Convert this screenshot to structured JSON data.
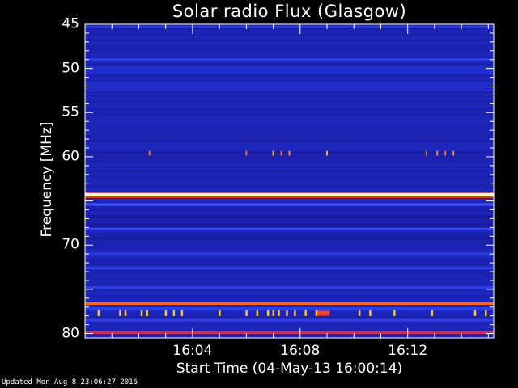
{
  "chart_data": {
    "type": "heatmap",
    "title": "Solar radio Flux (Glasgow)",
    "xlabel": "Start Time (04-May-13 16:00:14)",
    "ylabel": "Frequency [MHz]",
    "x_range_minutes": [
      0,
      15.2
    ],
    "x_ticks": [
      {
        "minute": 4,
        "label": "16:04"
      },
      {
        "minute": 8,
        "label": "16:08"
      },
      {
        "minute": 12,
        "label": "16:12"
      }
    ],
    "ylim": [
      45,
      80.5
    ],
    "y_ticks": [
      45,
      50,
      55,
      60,
      65,
      70,
      75,
      80
    ],
    "y_tick_labels": [
      "45",
      "50",
      "55",
      "60",
      "",
      "70",
      "",
      "80"
    ],
    "y_inverted": true,
    "colormap": [
      "#1a1a9a",
      "#2030d0",
      "#3c50ff",
      "#ff2020",
      "#ffb000",
      "#ffffb0"
    ],
    "background_level": 0.1,
    "bands": [
      {
        "freq": 45.3,
        "width": 0.2,
        "level": 0.35
      },
      {
        "freq": 49.0,
        "width": 0.3,
        "level": 0.28
      },
      {
        "freq": 50.2,
        "width": 0.8,
        "level": 0.2
      },
      {
        "freq": 52.0,
        "width": 1.0,
        "level": 0.18
      },
      {
        "freq": 59.5,
        "width": 0.3,
        "level": 0.03
      },
      {
        "freq": 64.3,
        "width": 0.4,
        "level": 1.0
      },
      {
        "freq": 65.4,
        "width": 0.3,
        "level": 0.4
      },
      {
        "freq": 66.8,
        "width": 0.5,
        "level": 0.01
      },
      {
        "freq": 67.7,
        "width": 0.4,
        "level": 0.02
      },
      {
        "freq": 68.2,
        "width": 0.3,
        "level": 0.35
      },
      {
        "freq": 69.3,
        "width": 0.3,
        "level": 0.02
      },
      {
        "freq": 71.0,
        "width": 0.4,
        "level": 0.25
      },
      {
        "freq": 72.6,
        "width": 0.3,
        "level": 0.3
      },
      {
        "freq": 74.8,
        "width": 0.3,
        "level": 0.3
      },
      {
        "freq": 75.8,
        "width": 0.3,
        "level": 0.05
      },
      {
        "freq": 76.6,
        "width": 0.3,
        "level": 0.7
      },
      {
        "freq": 77.2,
        "width": 0.3,
        "level": 0.3
      },
      {
        "freq": 78.5,
        "width": 0.3,
        "level": 0.28
      },
      {
        "freq": 79.9,
        "width": 0.3,
        "level": 0.55
      }
    ],
    "spots": [
      {
        "minute": 2.4,
        "freq": 59.6,
        "level": 0.7
      },
      {
        "minute": 6.0,
        "freq": 59.6,
        "level": 0.7
      },
      {
        "minute": 7.0,
        "freq": 59.6,
        "level": 0.8
      },
      {
        "minute": 7.3,
        "freq": 59.6,
        "level": 0.7
      },
      {
        "minute": 7.6,
        "freq": 59.6,
        "level": 0.75
      },
      {
        "minute": 9.0,
        "freq": 59.6,
        "level": 0.8
      },
      {
        "minute": 12.7,
        "freq": 59.6,
        "level": 0.7
      },
      {
        "minute": 13.1,
        "freq": 59.6,
        "level": 0.75
      },
      {
        "minute": 13.4,
        "freq": 59.6,
        "level": 0.7
      },
      {
        "minute": 13.7,
        "freq": 59.6,
        "level": 0.75
      }
    ],
    "bursts": {
      "freq": 77.7,
      "level": 0.85,
      "minutes": [
        0.5,
        1.3,
        1.5,
        2.1,
        2.3,
        3.0,
        3.3,
        3.6,
        5.0,
        6.0,
        6.4,
        6.8,
        7.0,
        7.2,
        7.5,
        7.8,
        8.2,
        8.6,
        10.2,
        10.6,
        11.5,
        12.9,
        14.5,
        14.9
      ],
      "block": {
        "from": 8.6,
        "to": 9.1,
        "level": 0.65
      }
    },
    "footer": "Updated Mon Aug  8 23:06:27 2016"
  }
}
